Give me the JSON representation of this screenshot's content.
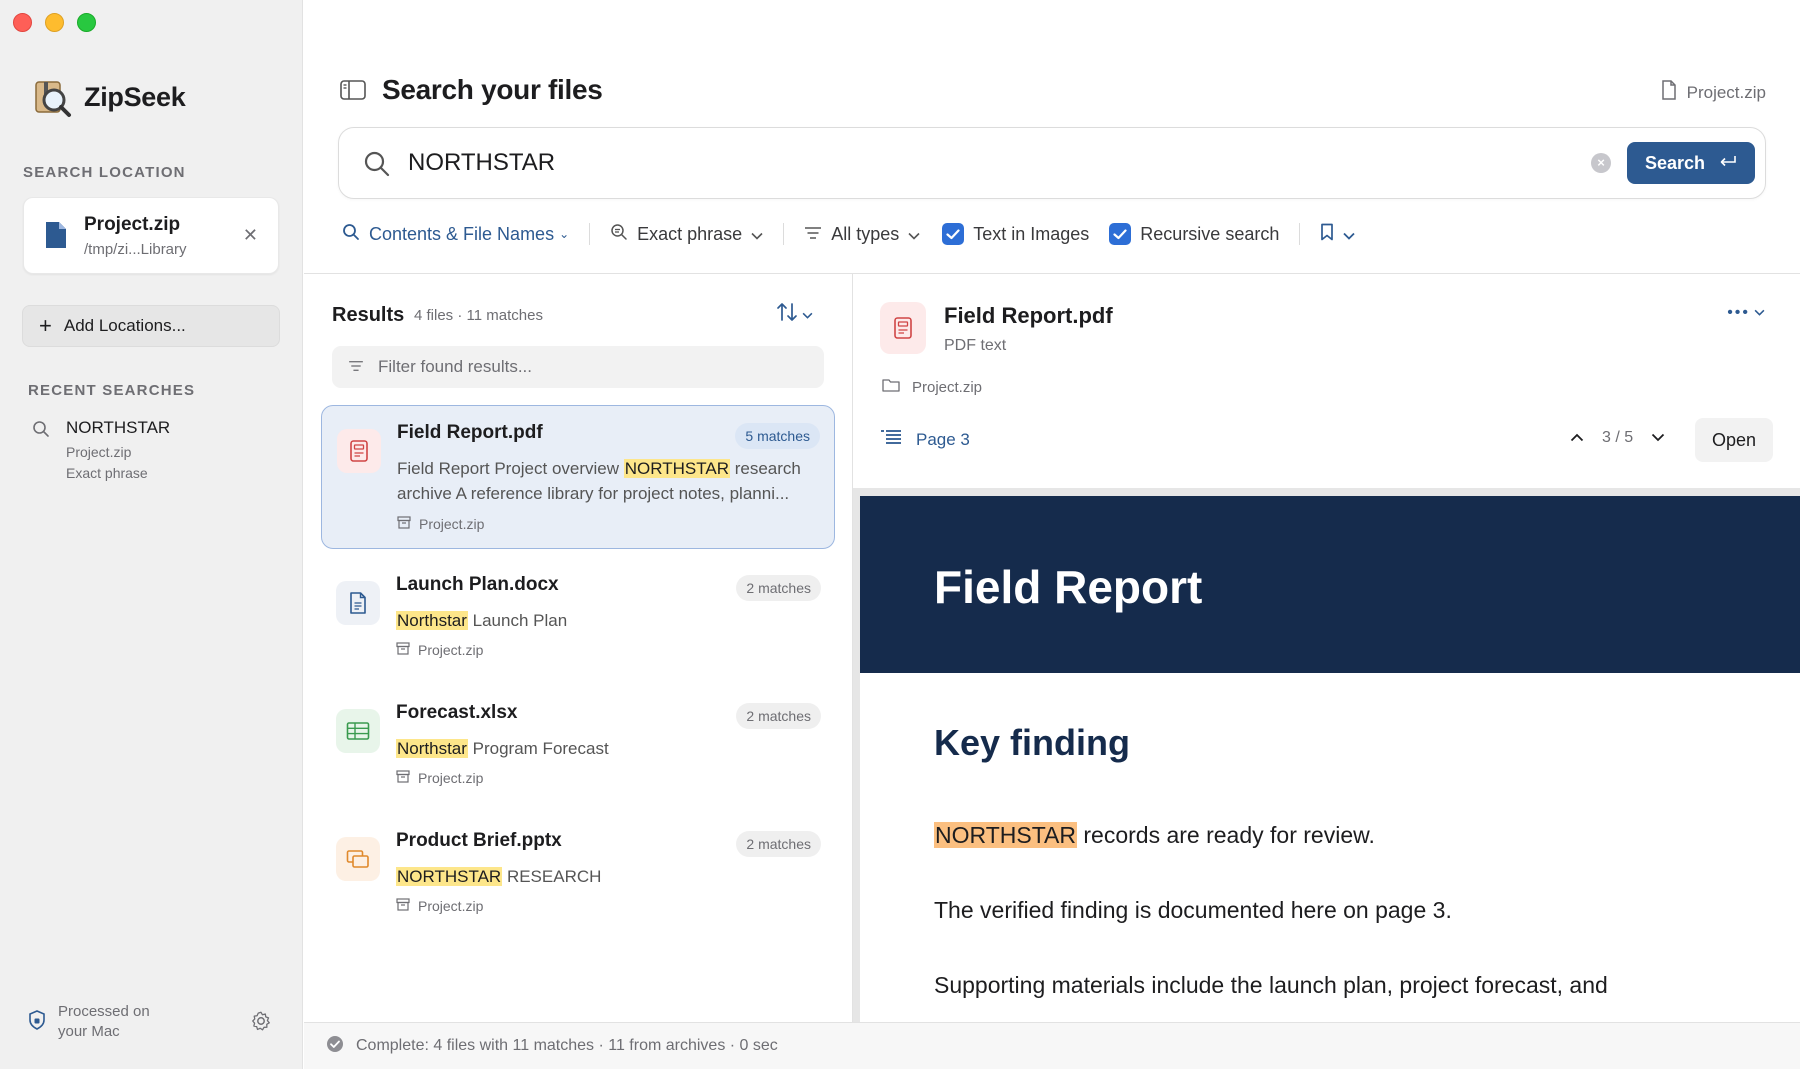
{
  "app": {
    "name": "ZipSeek"
  },
  "sidebar": {
    "search_location_heading": "SEARCH LOCATION",
    "location": {
      "title": "Project.zip",
      "path": "/tmp/zi...Library"
    },
    "add_locations_label": "Add Locations...",
    "recent_searches_heading": "RECENT SEARCHES",
    "recent": [
      {
        "query": "NORTHSTAR",
        "location": "Project.zip",
        "mode": "Exact phrase"
      }
    ],
    "processed_line1": "Processed on",
    "processed_line2": "your Mac"
  },
  "header": {
    "title": "Search your files",
    "current_file": "Project.zip"
  },
  "search": {
    "value": "NORTHSTAR",
    "placeholder": "",
    "button_label": "Search"
  },
  "filters": {
    "scope": "Contents & File Names",
    "match_mode": "Exact phrase",
    "types": "All types",
    "text_in_images": {
      "label": "Text in Images",
      "checked": true
    },
    "recursive": {
      "label": "Recursive search",
      "checked": true
    }
  },
  "results": {
    "title": "Results",
    "summary": "4 files · 11 matches",
    "filter_placeholder": "Filter found results...",
    "items": [
      {
        "name": "Field Report.pdf",
        "badge": "5 matches",
        "pre": "Field Report Project overview ",
        "hit": "NORTHSTAR",
        "post": " research",
        "line2": "archive A reference library for project notes, planni...",
        "archive": "Project.zip",
        "icon": "pdf-icon",
        "selected": true
      },
      {
        "name": "Launch Plan.docx",
        "badge": "2 matches",
        "pre": "",
        "hit": "Northstar",
        "post": " Launch Plan",
        "archive": "Project.zip",
        "icon": "document-icon"
      },
      {
        "name": "Forecast.xlsx",
        "badge": "2 matches",
        "pre": "",
        "hit": "Northstar",
        "post": " Program Forecast",
        "archive": "Project.zip",
        "icon": "spreadsheet-icon"
      },
      {
        "name": "Product Brief.pptx",
        "badge": "2 matches",
        "pre": "",
        "hit": "NORTHSTAR",
        "post": " RESEARCH",
        "archive": "Project.zip",
        "icon": "presentation-icon"
      }
    ]
  },
  "preview": {
    "file_name": "Field Report.pdf",
    "kind": "PDF text",
    "archive": "Project.zip",
    "page_label": "Page 3",
    "match_position": "3 / 5",
    "open_label": "Open",
    "document": {
      "banner_title": "Field Report",
      "heading": "Key finding",
      "p1_hit": "NORTHSTAR",
      "p1_rest": " records are ready for review.",
      "p2": "The verified finding is documented here on page 3.",
      "p3": "Supporting materials include the launch plan, project forecast, and"
    }
  },
  "status": {
    "text": "Complete: 4 files with 11 matches · 11 from archives · 0 sec"
  },
  "colors": {
    "accent": "#2d5a91",
    "checkbox": "#2d6ed6",
    "highlight": "#fde68a",
    "preview_highlight": "#fbbf80",
    "doc_banner": "#152b4c",
    "selected_card": "#e8eef7"
  }
}
